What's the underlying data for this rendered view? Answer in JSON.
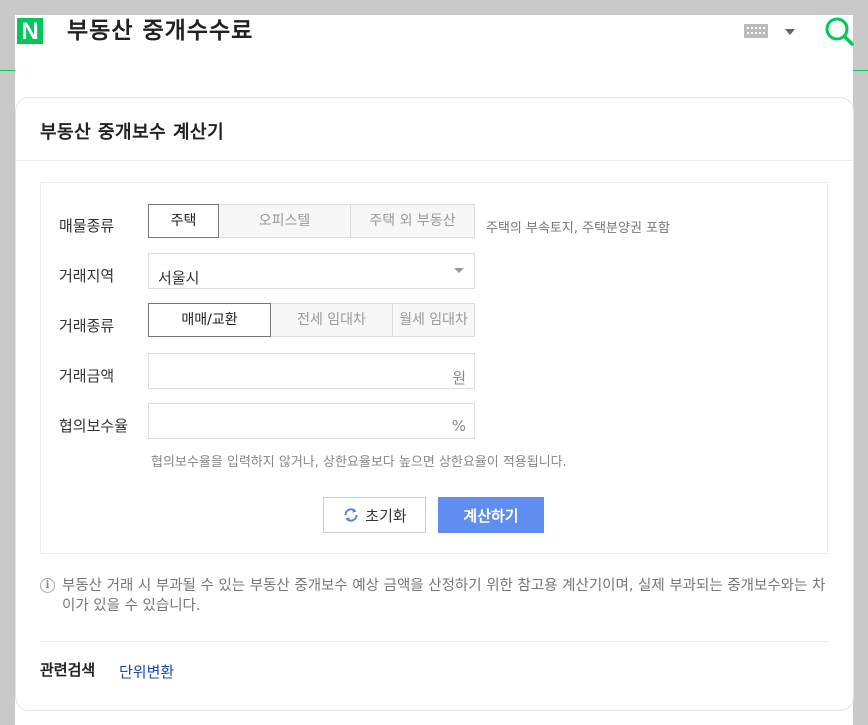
{
  "header": {
    "logo_text": "N",
    "title": "부동산 중개수수료",
    "icons": [
      "keyboard-icon",
      "caret-down-icon",
      "search-icon"
    ],
    "brand_color": "#03c75a"
  },
  "card": {
    "title": "부동산 중개보수 계산기"
  },
  "form": {
    "property_type": {
      "label": "매물종류",
      "options": [
        "주택",
        "오피스텔",
        "주택 외 부동산"
      ],
      "selected": "주택",
      "note": "주택의 부속토지, 주택분양권 포함"
    },
    "region": {
      "label": "거래지역",
      "value": "서울시"
    },
    "deal_type": {
      "label": "거래종류",
      "options": [
        "매매/교환",
        "전세 임대차",
        "월세 임대차"
      ],
      "selected": "매매/교환"
    },
    "amount": {
      "label": "거래금액",
      "value": "",
      "unit": "원"
    },
    "rate": {
      "label": "협의보수율",
      "value": "",
      "unit": "%",
      "hint": "협의보수율을 입력하지 않거나, 상한요율보다 높으면 상한요율이 적용됩니다."
    },
    "reset_label": "초기화",
    "calc_label": "계산하기",
    "accent_color": "#5f8ef0"
  },
  "info": {
    "text": "부동산 거래 시 부과될 수 있는 부동산 중개보수 예상 금액을 산정하기 위한 참고용 계산기이며, 실제 부과되는 중개보수와는 차이가 있을 수 있습니다."
  },
  "related": {
    "label": "관련검색",
    "link": "단위변환"
  }
}
